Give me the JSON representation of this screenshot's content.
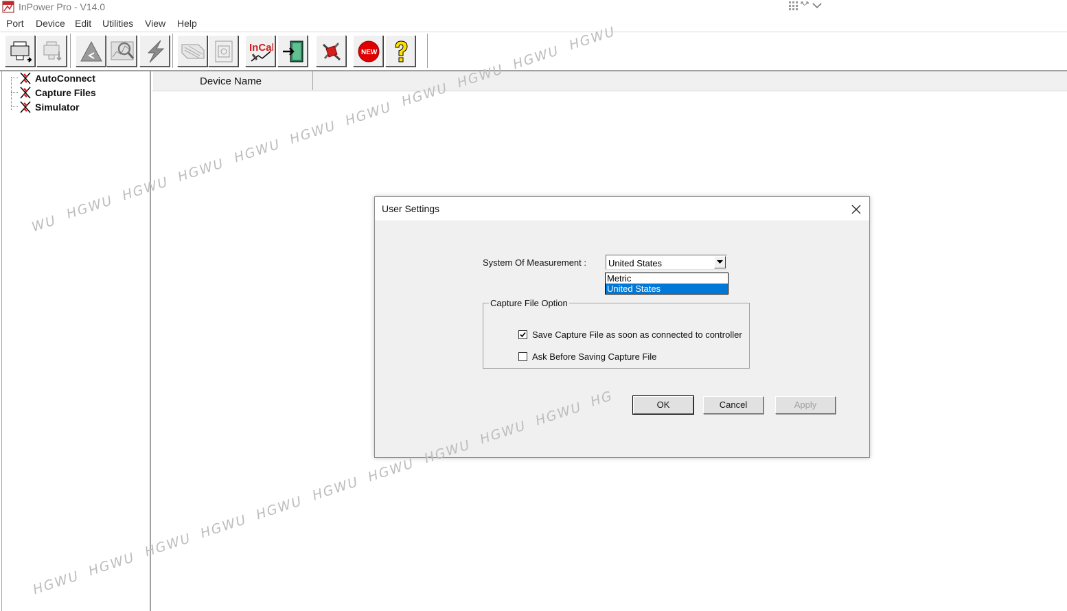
{
  "window": {
    "title": "InPower Pro - V14.0"
  },
  "menu": [
    "Port",
    "Device",
    "Edit",
    "Utilities",
    "View",
    "Help"
  ],
  "toolbar": {
    "buttons": [
      {
        "name": "connect-icon"
      },
      {
        "name": "disconnect-icon"
      },
      {
        "name": "upload-icon"
      },
      {
        "name": "monitor-icon"
      },
      {
        "name": "flash-icon"
      },
      {
        "name": "capture-icon"
      },
      {
        "name": "reports-icon"
      },
      {
        "name": "incal-icon",
        "text": "InCal"
      },
      {
        "name": "exit-icon"
      },
      {
        "name": "tools-icon"
      },
      {
        "name": "new-icon",
        "text": "NEW"
      },
      {
        "name": "help-icon"
      }
    ]
  },
  "tree": {
    "items": [
      "AutoConnect",
      "Capture Files",
      "Simulator"
    ]
  },
  "list": {
    "columns": [
      "Device Name"
    ]
  },
  "dialog": {
    "title": "User Settings",
    "measurement_label": "System Of Measurement :",
    "measurement_value": "United States",
    "measurement_options": [
      "Metric",
      "United States"
    ],
    "group_label": "Capture File Option",
    "options": [
      {
        "label": "Save Capture File as soon as connected to controller",
        "checked": true
      },
      {
        "label": "Ask Before Saving Capture File",
        "checked": false
      }
    ],
    "buttons": {
      "ok": "OK",
      "cancel": "Cancel",
      "apply": "Apply"
    }
  },
  "watermark": {
    "text": "HGWU",
    "fragment_left": "WU",
    "fragment_right": "HG"
  },
  "colors": {
    "selection": "#0078d7",
    "incal": "#d02020",
    "new_badge": "#e00000"
  }
}
